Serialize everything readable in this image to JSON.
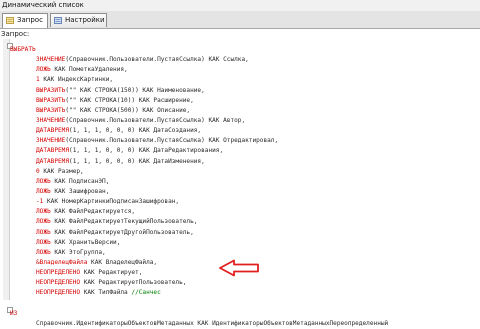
{
  "window": {
    "title": "Динамический список"
  },
  "tabs": [
    {
      "label": "Запрос",
      "icon": "query-icon"
    },
    {
      "label": "Настройки",
      "icon": "settings-icon"
    }
  ],
  "editor": {
    "label": "Запрос:",
    "lines": [
      {
        "kw": "ВЫБРАТЬ",
        "rest": "",
        "indent": 0
      },
      {
        "kw": "ЗНАЧЕНИЕ",
        "rest": "(Справочник.Пользователи.ПустаяСсылка) КАК Ссылка,",
        "indent": 1
      },
      {
        "kw": "ЛОЖЬ",
        "rest": " КАК ПометкаУдаления,",
        "indent": 1
      },
      {
        "kw": "1",
        "rest": " КАК ИндексКартинки,",
        "indent": 1
      },
      {
        "kw": "ВЫРАЗИТЬ",
        "rest": "(\"\" КАК СТРОКА(150)) КАК Наименование,",
        "indent": 1
      },
      {
        "kw": "ВЫРАЗИТЬ",
        "rest": "(\"\" КАК СТРОКА(10)) КАК Расширение,",
        "indent": 1
      },
      {
        "kw": "ВЫРАЗИТЬ",
        "rest": "(\"\" КАК СТРОКА(500)) КАК Описание,",
        "indent": 1
      },
      {
        "kw": "ЗНАЧЕНИЕ",
        "rest": "(Справочник.Пользователи.ПустаяСсылка) КАК Автор,",
        "indent": 1
      },
      {
        "kw": "ДАТАВРЕМЯ",
        "rest": "(1, 1, 1, 0, 0, 0) КАК ДатаСоздания,",
        "indent": 1
      },
      {
        "kw": "ЗНАЧЕНИЕ",
        "rest": "(Справочник.Пользователи.ПустаяСсылка) КАК Отредактировал,",
        "indent": 1
      },
      {
        "kw": "ДАТАВРЕМЯ",
        "rest": "(1, 1, 1, 0, 0, 0) КАК ДатаРедактирования,",
        "indent": 1
      },
      {
        "kw": "ДАТАВРЕМЯ",
        "rest": "(1, 1, 1, 0, 0, 0) КАК ДатаИзменения,",
        "indent": 1
      },
      {
        "kw": "0",
        "rest": " КАК Размер,",
        "indent": 1
      },
      {
        "kw": "ЛОЖЬ",
        "rest": " КАК ПодписанЭП,",
        "indent": 1
      },
      {
        "kw": "ЛОЖЬ",
        "rest": " КАК Зашифрован,",
        "indent": 1
      },
      {
        "kw": "-1",
        "rest": " КАК НомерКартинкиПодписанЗашифрован,",
        "indent": 1
      },
      {
        "kw": "ЛОЖЬ",
        "rest": " КАК ФайлРедактируется,",
        "indent": 1
      },
      {
        "kw": "ЛОЖЬ",
        "rest": " КАК ФайлРедактируетТекущийПользователь,",
        "indent": 1
      },
      {
        "kw": "ЛОЖЬ",
        "rest": " КАК ФайлРедактируетДругойПользователь,",
        "indent": 1
      },
      {
        "kw": "ЛОЖЬ",
        "rest": " КАК ХранитьВерсии,",
        "indent": 1
      },
      {
        "kw": "ЛОЖЬ",
        "rest": " КАК ЭтоГруппа,",
        "indent": 1
      },
      {
        "kw": "&ВладелецФайла",
        "rest": " КАК ВладелецФайла,",
        "indent": 1
      },
      {
        "kw": "НЕОПРЕДЕЛЕНО",
        "rest": " КАК Редактирует,",
        "indent": 1
      },
      {
        "kw": "НЕОПРЕДЕЛЕНО",
        "rest": " КАК РедактируетПользователь,",
        "indent": 1
      },
      {
        "kw": "НЕОПРЕДЕЛЕНО",
        "rest": " КАК ТипФайла ",
        "comment": "//Санчес",
        "indent": 1
      },
      {
        "kw": "",
        "rest": "",
        "indent": 0
      },
      {
        "kw": "ИЗ",
        "rest": "",
        "indent": 0
      },
      {
        "kw": "",
        "rest": "Справочник.ИдентификаторыОбъектовМетаданных КАК ИдентификаторыОбъектовМетаданныхПереопределенный",
        "indent": 1
      }
    ]
  },
  "annotation": {
    "arrow_color": "#e02020"
  }
}
